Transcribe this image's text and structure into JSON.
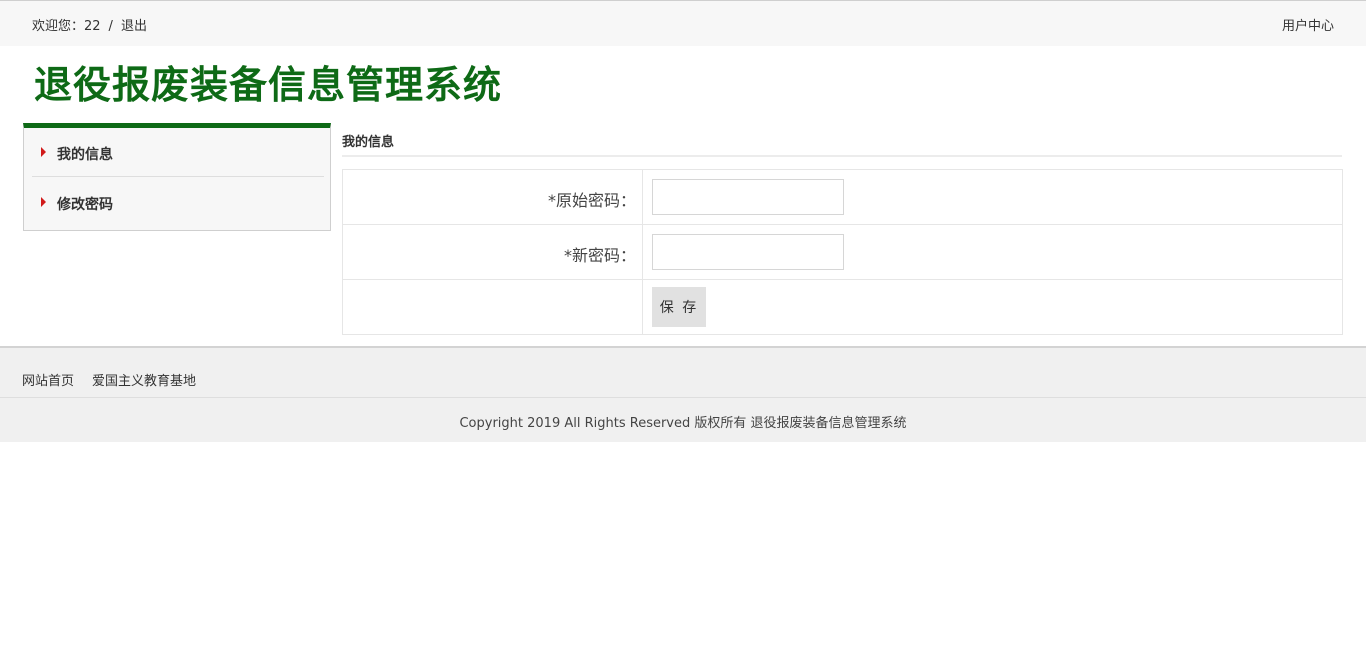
{
  "topbar": {
    "welcome": "欢迎您：22",
    "separator": "/",
    "logout": "退出",
    "user_center": "用户中心"
  },
  "site": {
    "title": "退役报废装备信息管理系统"
  },
  "sidebar": {
    "items": [
      {
        "label": "我的信息"
      },
      {
        "label": "修改密码"
      }
    ]
  },
  "main": {
    "section_title": "我的信息",
    "form": {
      "old_password_label": "*原始密码：",
      "old_password_value": "",
      "new_password_label": "*新密码：",
      "new_password_value": "",
      "save_label": "保 存"
    }
  },
  "footer": {
    "links": [
      "网站首页",
      "爱国主义教育基地"
    ],
    "copyright": "Copyright 2019 All Rights Reserved 版权所有 退役报废装备信息管理系统"
  },
  "colors": {
    "brand_green": "#0e6a16",
    "arrow_red": "#d11a1a"
  },
  "icons": {
    "sidebar_item_marker": "triangle-right-icon"
  }
}
